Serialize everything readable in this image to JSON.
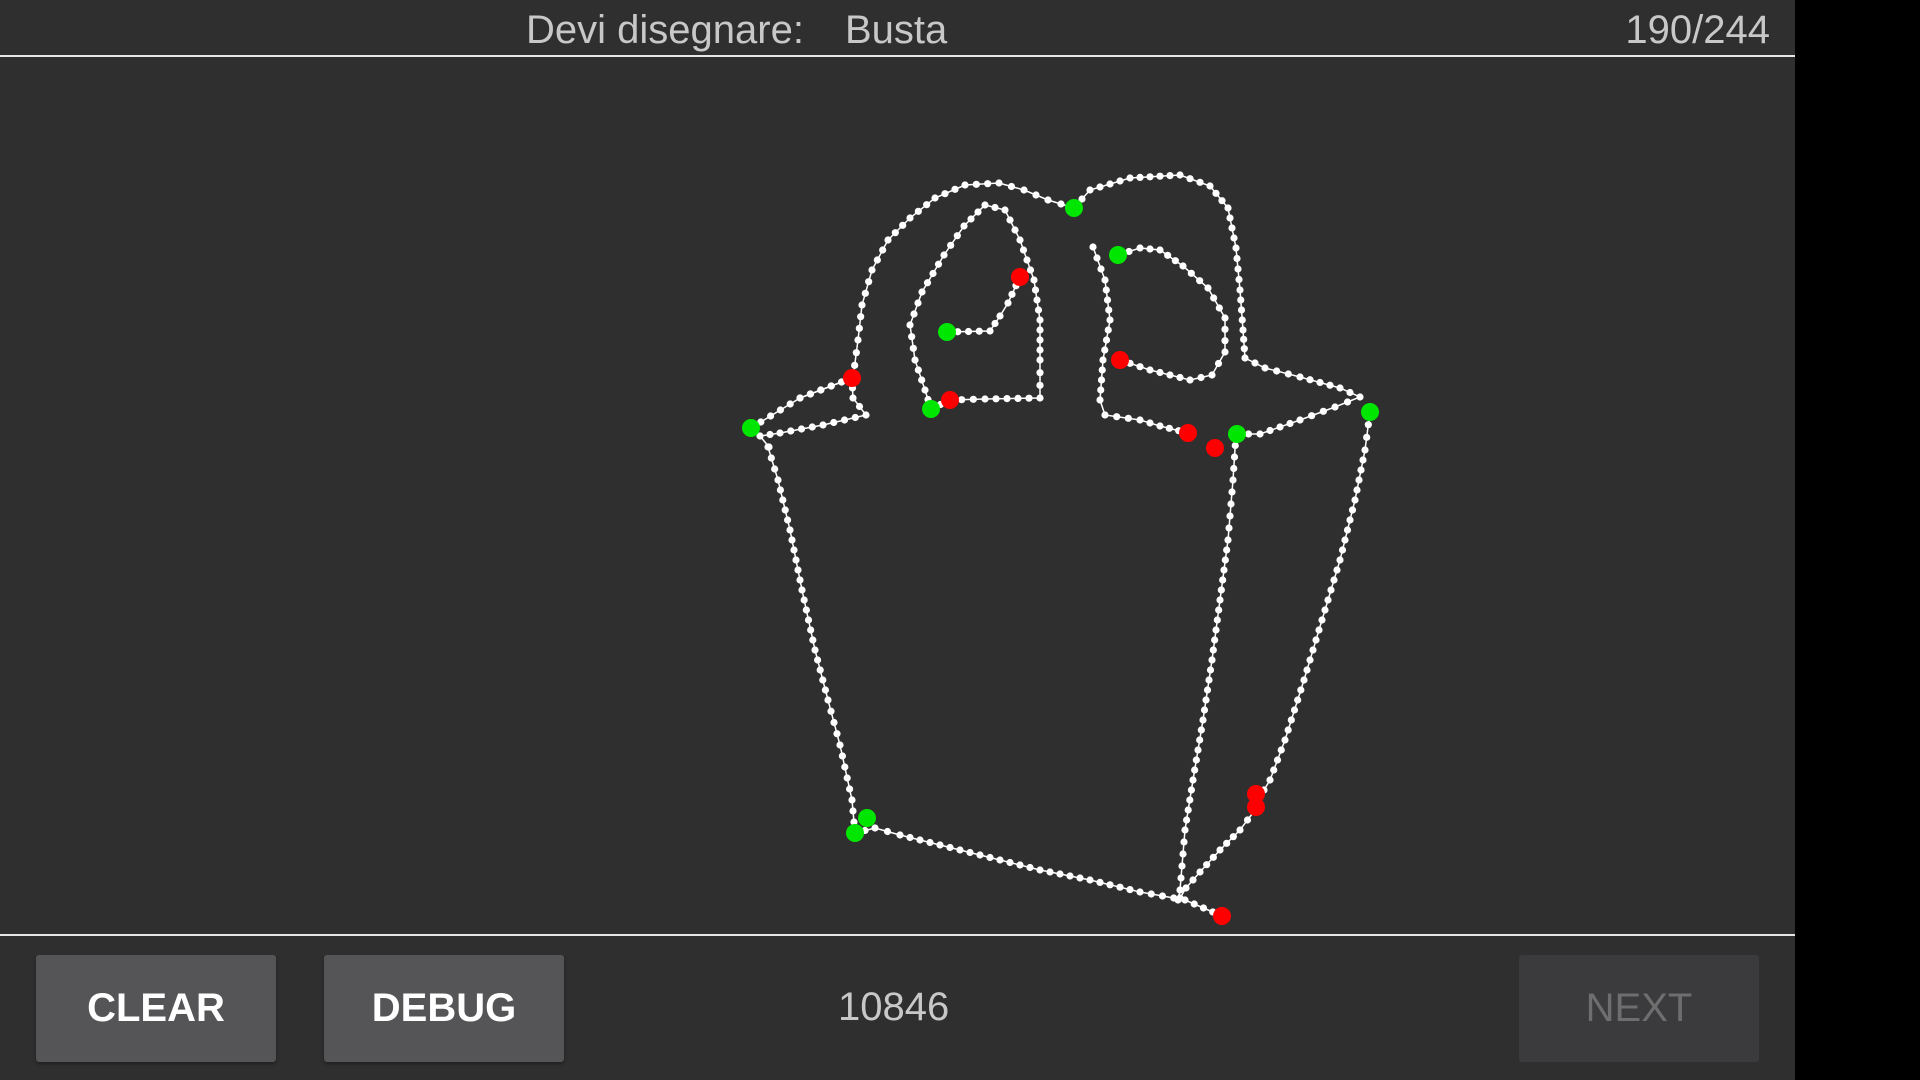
{
  "header": {
    "prompt_label": "Devi disegnare:",
    "prompt_word": "Busta",
    "progress": "190/244"
  },
  "footer": {
    "clear_label": "CLEAR",
    "debug_label": "DEBUG",
    "score": "10846",
    "next_label": "NEXT",
    "next_enabled": false
  },
  "colors": {
    "background": "#2f2f2f",
    "stroke": "#ffffff",
    "stroke_start": "#00e600",
    "stroke_end": "#ff0000"
  },
  "drawing": {
    "subject": "bag",
    "stroke_count": 10
  }
}
